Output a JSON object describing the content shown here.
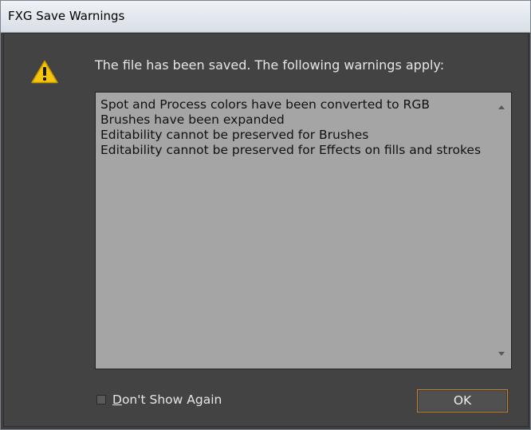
{
  "window": {
    "title": "FXG Save Warnings"
  },
  "dialog": {
    "icon": "warning-triangle-icon",
    "message": "The file has been saved. The following warnings apply:",
    "warnings": [
      "Spot and Process colors have been converted to RGB",
      "Brushes have been expanded",
      "Editability cannot be preserved for Brushes",
      "Editability cannot be preserved for Effects on fills and strokes"
    ],
    "dont_show_again_label": "Don't Show Again",
    "dont_show_again_checked": false,
    "ok_label": "OK"
  },
  "colors": {
    "dialog_background": "#434343",
    "list_background": "#a5a5a5",
    "warning_icon": "#f5c60c",
    "button_focus_border": "#c8802a"
  }
}
